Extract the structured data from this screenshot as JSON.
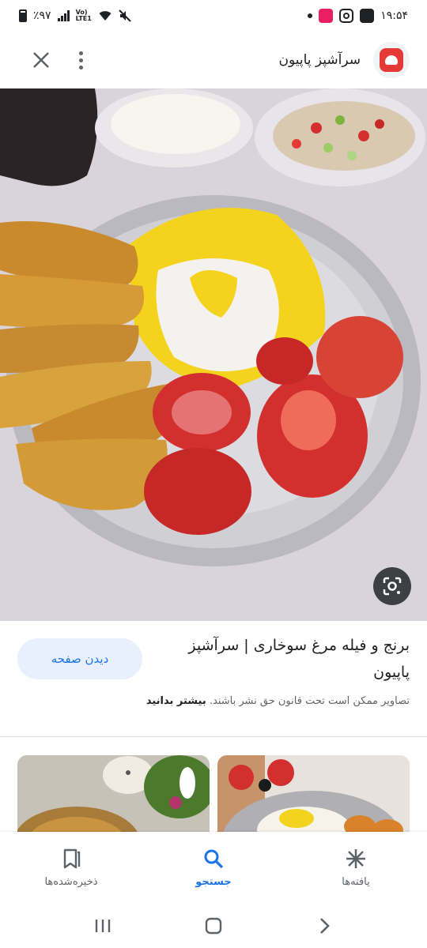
{
  "status_bar": {
    "battery_text": "٪۹۷",
    "lte_top": "Vo)",
    "lte_bottom": "LTE1",
    "time": "۱۹:۵۴"
  },
  "header": {
    "site_name": "سرآشپز پاپیون",
    "logo_icon": "chef-hat-icon",
    "close_icon": "close-icon",
    "more_icon": "more-vert-icon"
  },
  "main_image": {
    "alt": "chicken fillet with rice and tomatoes",
    "lens_icon": "google-lens-icon"
  },
  "info": {
    "title": "برنج و فیله مرغ سوخاری | سرآشپز پاپیون",
    "visit_button": "دیدن صفحه",
    "notice_text": "تصاویر ممکن است تحت قانون حق نشر باشند.",
    "learn_more": "بیشتر بدانید"
  },
  "bottom_nav": {
    "items": [
      {
        "label": "یافته‌ها",
        "icon": "discover-asterisk-icon",
        "active": false
      },
      {
        "label": "جستجو",
        "icon": "search-icon",
        "active": true
      },
      {
        "label": "ذخیره‌شده‌ها",
        "icon": "saved-collections-icon",
        "active": false
      }
    ]
  },
  "colors": {
    "accent": "#1a73e8",
    "accent_bg": "#e8f0fe",
    "text": "#202124",
    "muted": "#5f6368"
  }
}
